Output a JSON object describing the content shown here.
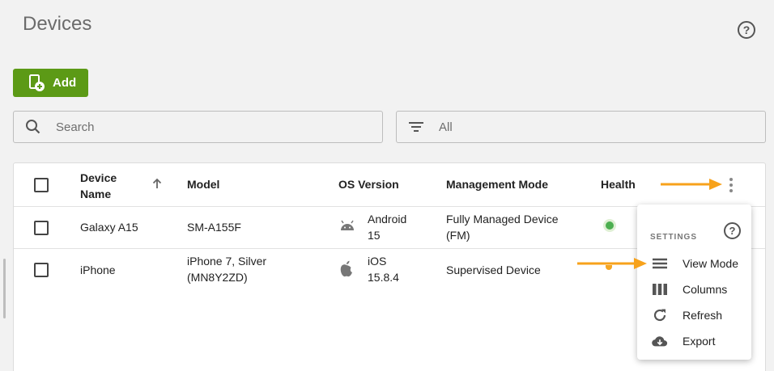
{
  "header": {
    "title": "Devices",
    "help_icon": "help-circle-icon"
  },
  "toolbar": {
    "add_label": "Add"
  },
  "search": {
    "placeholder": "Search"
  },
  "filter": {
    "value": "All"
  },
  "table": {
    "columns": {
      "device_name": "Device\nName",
      "model": "Model",
      "os_version": "OS Version",
      "management_mode": "Management Mode",
      "health": "Health"
    },
    "rows": [
      {
        "device_name": "Galaxy A15",
        "model": "SM-A155F",
        "os_icon": "android-icon",
        "os_version": "Android\n15",
        "management_mode": "Fully Managed Device\n(FM)",
        "health_color": "#4caf50"
      },
      {
        "device_name": "iPhone",
        "model": "iPhone 7, Silver\n(MN8Y2ZD)",
        "os_icon": "apple-icon",
        "os_version": "iOS\n15.8.4",
        "management_mode": "Supervised Device",
        "health_color": "#f5a623"
      }
    ]
  },
  "settings_menu": {
    "heading": "SETTINGS",
    "items": [
      {
        "label": "View Mode",
        "icon": "view-mode-icon"
      },
      {
        "label": "Columns",
        "icon": "columns-icon"
      },
      {
        "label": "Refresh",
        "icon": "refresh-icon"
      },
      {
        "label": "Export",
        "icon": "export-icon"
      }
    ]
  },
  "colors": {
    "accent": "#5c9a16",
    "arrow": "#f7a21b"
  }
}
